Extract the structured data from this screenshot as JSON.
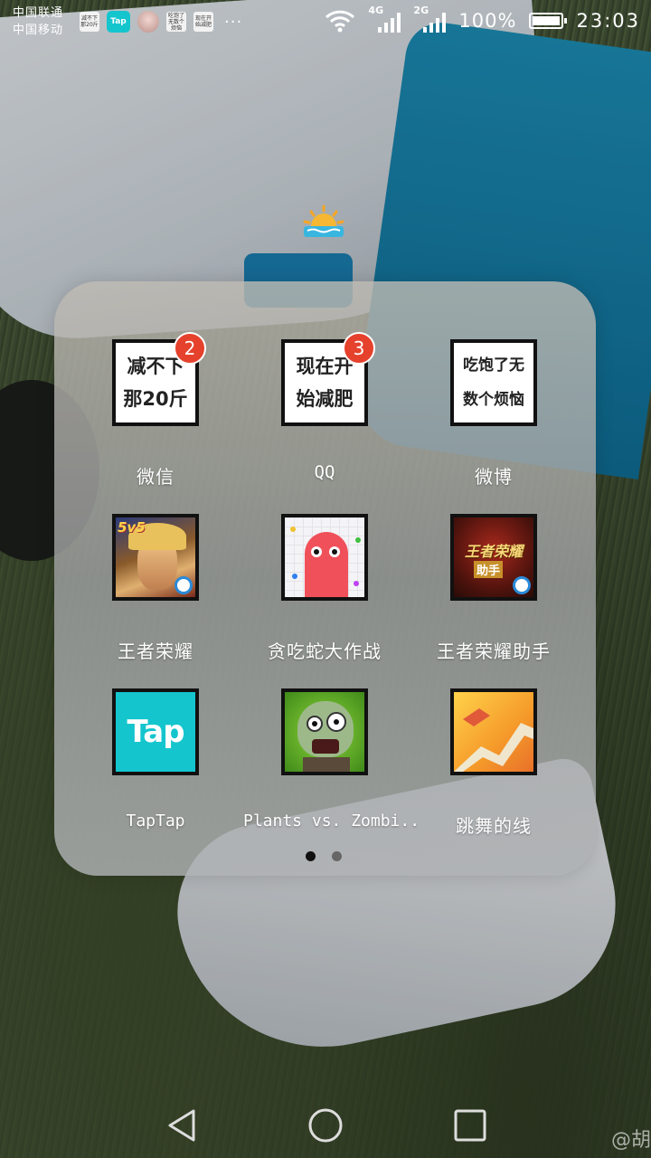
{
  "status_bar": {
    "carrier_1": "中国联通",
    "carrier_2": "中国移动",
    "notifications": [
      {
        "name": "app-notification-icon",
        "text": "减不下那20斤"
      },
      {
        "name": "taptap-icon",
        "text": "Tap"
      },
      {
        "name": "avatar-icon",
        "text": ""
      },
      {
        "name": "app-notification-icon",
        "text": "吃饱了无数个烦恼"
      },
      {
        "name": "app-notification-icon",
        "text": "现在开始减肥"
      }
    ],
    "more": "···",
    "network_1": "4G",
    "network_2": "2G",
    "battery_percent": "100%",
    "battery_level": 100,
    "time": "23:03"
  },
  "weather_icon": "sunrise-icon",
  "folder": {
    "apps": [
      {
        "name": "微信",
        "icon_line1": "减不下",
        "icon_line2": "那20斤",
        "badge": "2"
      },
      {
        "name": "QQ",
        "icon_line1": "现在开",
        "icon_line2": "始减肥",
        "badge": "3"
      },
      {
        "name": "微博",
        "icon_line1": "吃饱了无",
        "icon_line2": "数个烦恼",
        "badge": ""
      },
      {
        "name": "王者荣耀",
        "icon_badge_text": "5v5",
        "badge": ""
      },
      {
        "name": "贪吃蛇大作战",
        "badge": ""
      },
      {
        "name": "王者荣耀助手",
        "icon_line1": "王者荣耀",
        "icon_line2": "助手",
        "badge": ""
      },
      {
        "name": "TapTap",
        "icon_text": "Tap",
        "badge": ""
      },
      {
        "name": "Plants vs. Zombi..",
        "badge": ""
      },
      {
        "name": "跳舞的线",
        "badge": ""
      }
    ],
    "page_count": 2,
    "active_page": 1
  },
  "nav": {
    "back": "back-triangle-icon",
    "home": "home-circle-icon",
    "recents": "recents-square-icon"
  },
  "watermark": "@胡",
  "colors": {
    "badge": "#e5412c",
    "taptap": "#15c5ce"
  }
}
